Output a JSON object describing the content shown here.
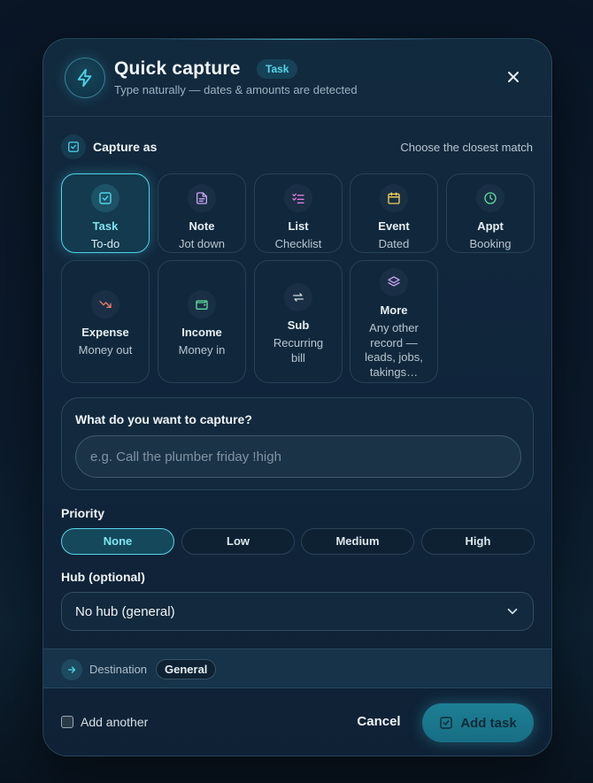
{
  "header": {
    "title": "Quick capture",
    "badge": "Task",
    "subtitle": "Type naturally — dates & amounts are detected"
  },
  "capture": {
    "label": "Capture as",
    "hint": "Choose the closest match",
    "types": [
      {
        "label": "Task",
        "sub": "To-do",
        "icon": "check-square-icon",
        "color": "#4fd3e6",
        "selected": true
      },
      {
        "label": "Note",
        "sub": "Jot down",
        "icon": "document-icon",
        "color": "#c9a4f2",
        "selected": false
      },
      {
        "label": "List",
        "sub": "Checklist",
        "icon": "checklist-icon",
        "color": "#e07ad8",
        "selected": false
      },
      {
        "label": "Event",
        "sub": "Dated",
        "icon": "calendar-icon",
        "color": "#f0cf55",
        "selected": false
      },
      {
        "label": "Appt",
        "sub": "Booking",
        "icon": "clock-icon",
        "color": "#5edb9a",
        "selected": false
      },
      {
        "label": "Expense",
        "sub": "Money out",
        "icon": "trend-down-icon",
        "color": "#f07b6e",
        "selected": false
      },
      {
        "label": "Income",
        "sub": "Money in",
        "icon": "wallet-icon",
        "color": "#5edb9a",
        "selected": false
      },
      {
        "label": "Sub",
        "sub": "Recurring bill",
        "icon": "repeat-icon",
        "color": "#cfd8de",
        "selected": false
      },
      {
        "label": "More",
        "sub": "Any other record — leads, jobs, takings…",
        "icon": "layers-icon",
        "color": "#c9a4f2",
        "selected": false
      }
    ]
  },
  "input": {
    "question": "What do you want to capture?",
    "placeholder": "e.g. Call the plumber friday !high",
    "value": ""
  },
  "priority": {
    "label": "Priority",
    "options": [
      "None",
      "Low",
      "Medium",
      "High"
    ],
    "selected": "None"
  },
  "hub": {
    "label": "Hub (optional)",
    "value": "No hub (general)"
  },
  "destination": {
    "label": "Destination",
    "value": "General"
  },
  "footer": {
    "add_another": "Add another",
    "cancel": "Cancel",
    "submit": "Add task"
  },
  "colors": {
    "accent": "#4fd3e6",
    "primary_button": "#1d7f95",
    "background": "#0b1a2b"
  }
}
